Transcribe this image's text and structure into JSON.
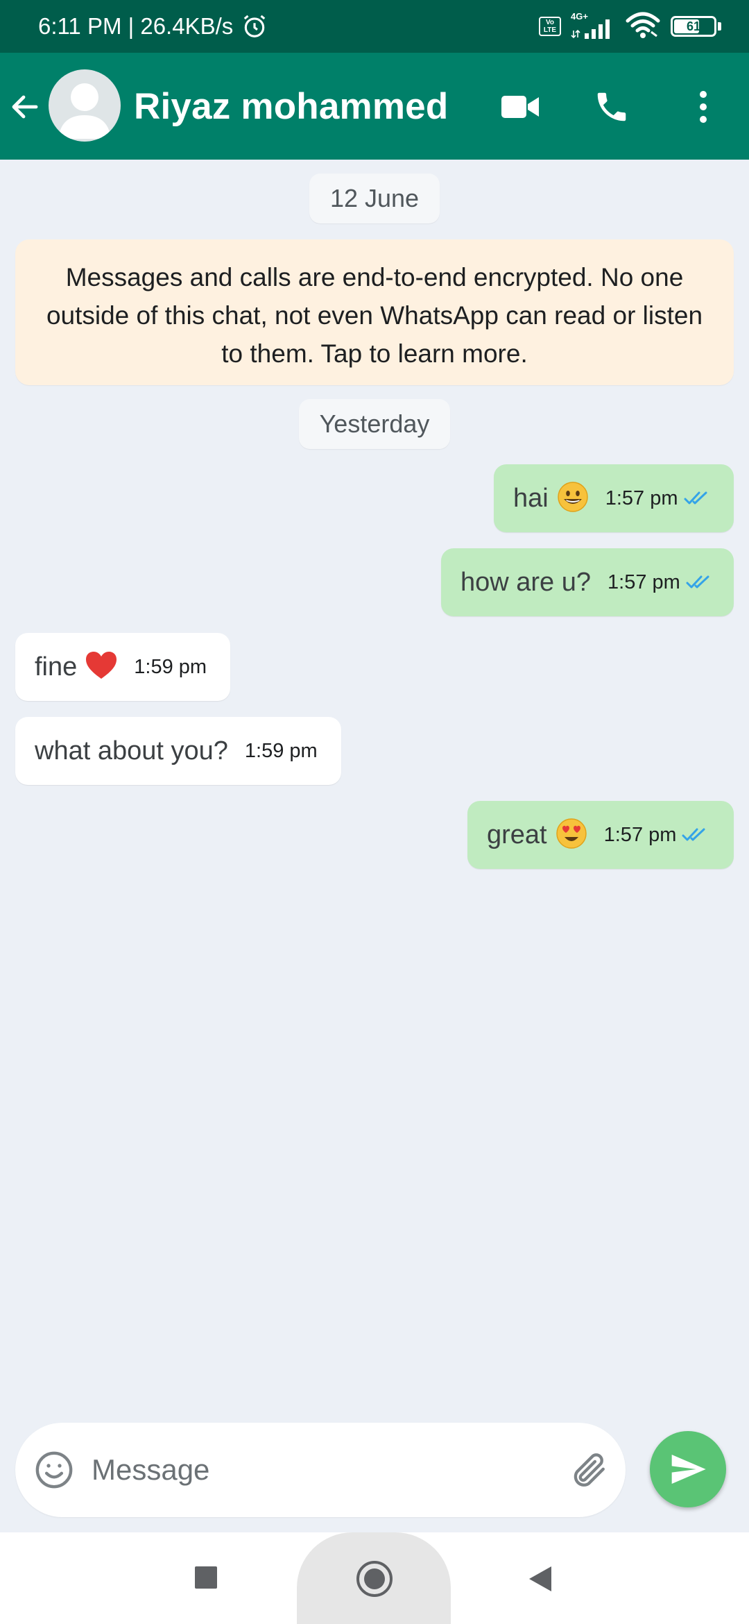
{
  "status_bar": {
    "time_speed": "6:11 PM | 26.4KB/s",
    "volte_label": "Vo\nLTE",
    "network_type": "4G+",
    "battery": "61"
  },
  "header": {
    "contact_name": "Riyaz mohammed",
    "icons": [
      "back-arrow-icon",
      "avatar",
      "video-call-icon",
      "phone-icon",
      "more-vertical-icon"
    ]
  },
  "chat": {
    "date_chip_1": "12 June",
    "encryption_notice": "Messages and calls are end-to-end encrypted. No one outside of this chat, not even WhatsApp can read or listen to them. Tap to learn more.",
    "date_chip_2": "Yesterday",
    "messages": [
      {
        "direction": "out",
        "text": "hai",
        "emoji": "grinning-face",
        "time": "1:57 pm",
        "status": "read"
      },
      {
        "direction": "out",
        "text": "how are u?",
        "time": "1:57 pm",
        "status": "read"
      },
      {
        "direction": "in",
        "text": "fine",
        "emoji": "red-heart",
        "time": "1:59 pm"
      },
      {
        "direction": "in",
        "text": "what about you?",
        "time": "1:59 pm"
      },
      {
        "direction": "out",
        "text": "great",
        "emoji": "heart-eyes-face",
        "time": "1:57 pm",
        "status": "read"
      }
    ]
  },
  "composer": {
    "placeholder": "Message"
  },
  "colors": {
    "status_bar": "#005d4b",
    "app_bar": "#008069",
    "chat_bg": "#ecf0f6",
    "outgoing_bubble": "#c0ebc0",
    "incoming_bubble": "#ffffff",
    "encryption_bg": "#fef1e0",
    "send_button": "#5ac475",
    "read_ticks": "#34a3e8"
  }
}
